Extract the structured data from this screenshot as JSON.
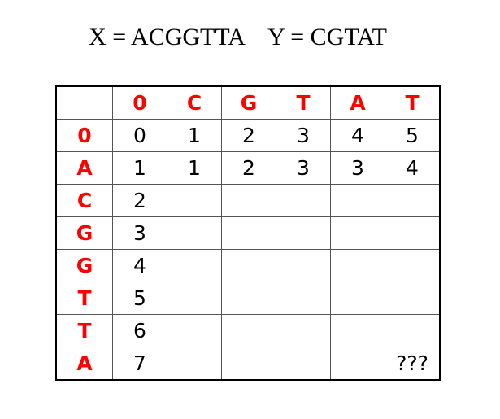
{
  "title": "X = ACGGTTA    Y = CGTAT",
  "colors": {
    "header": "#ff0000",
    "text": "#000000",
    "grid": "#555555"
  },
  "table": {
    "corner": "",
    "col_headers": [
      "0",
      "C",
      "G",
      "T",
      "A",
      "T"
    ],
    "row_headers": [
      "0",
      "A",
      "C",
      "G",
      "G",
      "T",
      "T",
      "A"
    ],
    "rows": [
      [
        "0",
        "1",
        "2",
        "3",
        "4",
        "5"
      ],
      [
        "1",
        "1",
        "2",
        "3",
        "3",
        "4"
      ],
      [
        "2",
        "",
        "",
        "",
        "",
        ""
      ],
      [
        "3",
        "",
        "",
        "",
        "",
        ""
      ],
      [
        "4",
        "",
        "",
        "",
        "",
        ""
      ],
      [
        "5",
        "",
        "",
        "",
        "",
        ""
      ],
      [
        "6",
        "",
        "",
        "",
        "",
        ""
      ],
      [
        "7",
        "",
        "",
        "",
        "",
        "???"
      ]
    ]
  }
}
